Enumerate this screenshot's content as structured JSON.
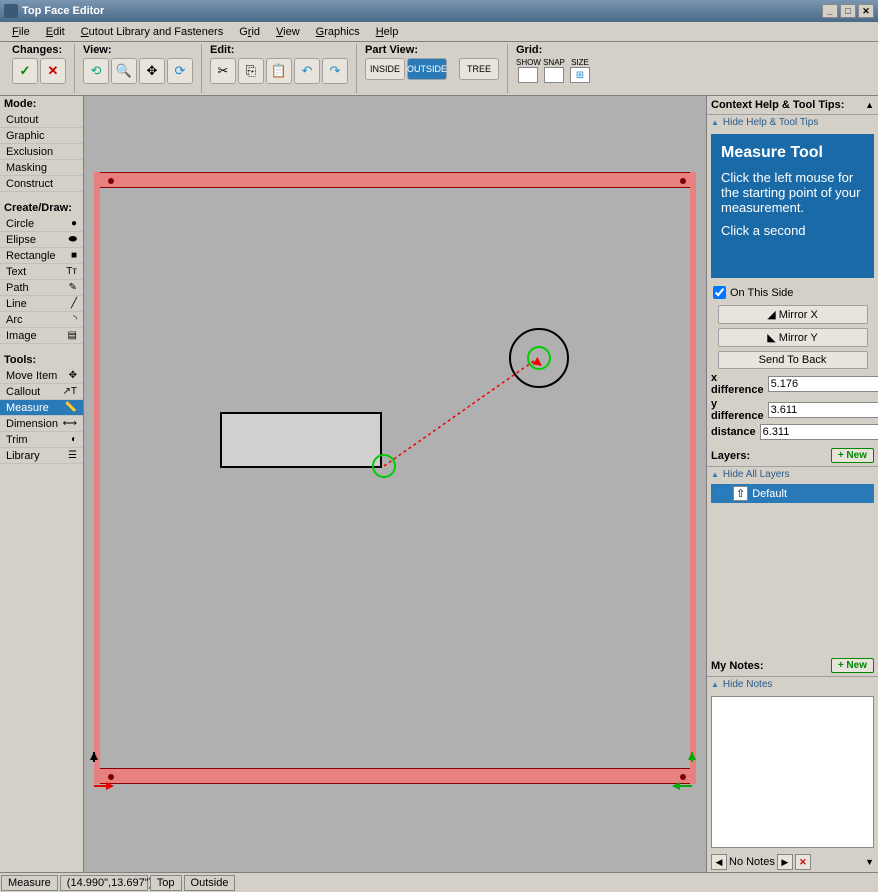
{
  "window": {
    "title": "Top Face Editor"
  },
  "menu": {
    "file": "File",
    "edit": "Edit",
    "cutout": "Cutout Library and Fasteners",
    "grid": "Grid",
    "view": "View",
    "graphics": "Graphics",
    "help": "Help"
  },
  "toolbar": {
    "changes": "Changes:",
    "view": "View:",
    "edit": "Edit:",
    "partview": "Part View:",
    "grid": "Grid:",
    "inside": "INSIDE",
    "outside": "OUTSIDE",
    "tree": "TREE",
    "show": "SHOW",
    "snap": "SNAP",
    "size": "SIZE"
  },
  "mode": {
    "title": "Mode:",
    "items": [
      "Cutout",
      "Graphic",
      "Exclusion",
      "Masking",
      "Construct"
    ]
  },
  "create": {
    "title": "Create/Draw:",
    "items": [
      "Circle",
      "Elipse",
      "Rectangle",
      "Text",
      "Path",
      "Line",
      "Arc",
      "Image"
    ]
  },
  "tools": {
    "title": "Tools:",
    "items": [
      "Move Item",
      "Callout",
      "Measure",
      "Dimension",
      "Trim",
      "Library"
    ],
    "selected_index": 2
  },
  "context": {
    "title": "Context Help & Tool Tips:",
    "hide": "Hide Help & Tool Tips",
    "help_title": "Measure Tool",
    "help_body1": "Click the left mouse for the starting point of your measurement.",
    "help_body2": "Click a second"
  },
  "side": {
    "onthis": "On This Side",
    "mirrorx": "Mirror X",
    "mirrory": "Mirror Y",
    "sendback": "Send To Back"
  },
  "measure": {
    "xdiff_label": "x difference",
    "xdiff": "5.176",
    "ydiff_label": "y difference",
    "ydiff": "3.611",
    "dist_label": "distance",
    "dist": "6.311"
  },
  "layers": {
    "title": "Layers:",
    "new": "+ New",
    "hideall": "Hide All Layers",
    "default": "Default"
  },
  "notes": {
    "title": "My Notes:",
    "new": "+ New",
    "hide": "Hide Notes",
    "none": "No Notes"
  },
  "status": {
    "tool": "Measure",
    "coords": "(14.990\",13.697\")",
    "face": "Top",
    "side": "Outside"
  }
}
